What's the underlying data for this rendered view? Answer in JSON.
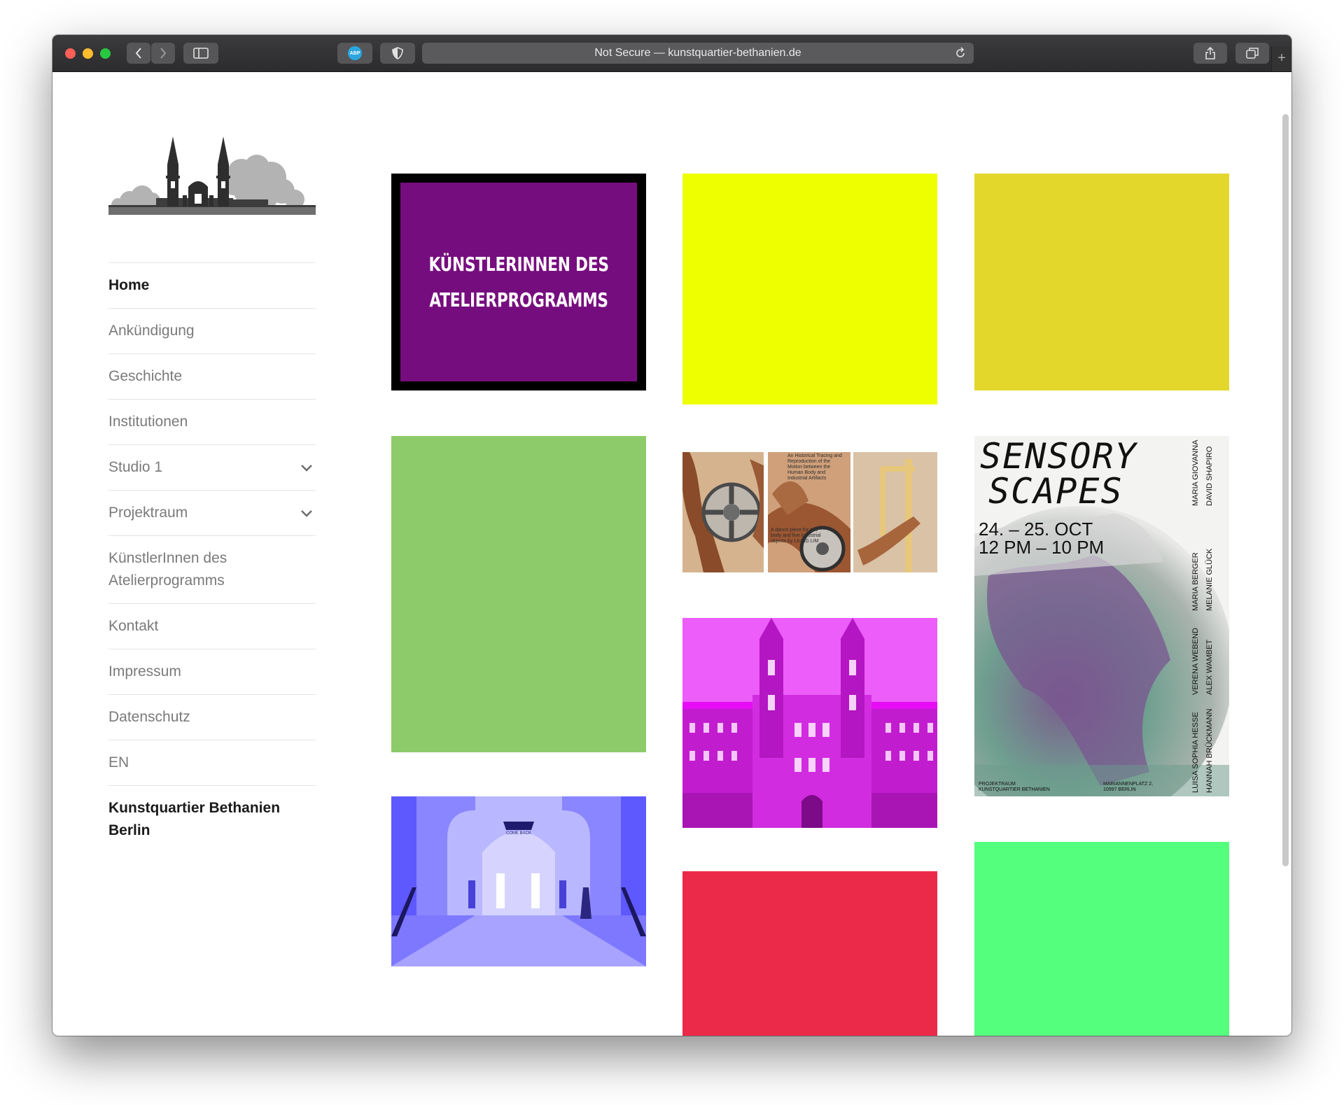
{
  "browser": {
    "address_text": "Not Secure — kunstquartier-bethanien.de",
    "adblock_label": "ABP"
  },
  "nav": {
    "items": [
      {
        "label": "Home",
        "active": true
      },
      {
        "label": "Ankündigung"
      },
      {
        "label": "Geschichte"
      },
      {
        "label": "Institutionen"
      },
      {
        "label": "Studio 1",
        "has_submenu": true
      },
      {
        "label": "Projektraum",
        "has_submenu": true
      },
      {
        "label": "KünstlerInnen des Atelierprogramms"
      },
      {
        "label": "Kontakt"
      },
      {
        "label": "Impressum"
      },
      {
        "label": "Datenschutz"
      },
      {
        "label": "EN"
      }
    ],
    "site_title": "Kunstquartier Bethanien Berlin"
  },
  "tiles": {
    "featured_line1": "KÜNSTLERINNEN DES",
    "featured_line2": "ATELIERPROGRAMMS",
    "dance_text_1": "An Historical Tracing and Reproduction of the Motion between the Human Body and Industrial Artifacts",
    "dance_text_2": "A dance piece for one body and five industrial objects by LIUNG LIM",
    "sensory_title_1": "SENSORY",
    "sensory_title_2": "SCAPES",
    "sensory_date": "24. – 25. OCT",
    "sensory_time": "12 PM – 10 PM",
    "sensory_venue": "PROJEKTRAUM KUNSTQUARTIER BETHANIEN",
    "sensory_address": "MARIANNENPLATZ 2, 10997 BERLIN",
    "sensory_artists": [
      "MARIA GIOVANNA",
      "DAVID SHAPIRO",
      "MARIA BERGER",
      "MELANIE GLÜCK",
      "VERENA WEBEND",
      "ALEX WAMBET",
      "LUISA SOPHIA HESSE",
      "HANNAH BRÜCKMANN"
    ],
    "hall_sign": "COME BACK"
  },
  "colors": {
    "purple": "#760d7e",
    "yellow": "#eeff00",
    "mustard": "#e3d72b",
    "green": "#8dcb6a",
    "magenta": "#e60df6",
    "hall_blue": "#6a64ff",
    "red": "#eb2a49",
    "neon_green": "#55ff7e"
  }
}
